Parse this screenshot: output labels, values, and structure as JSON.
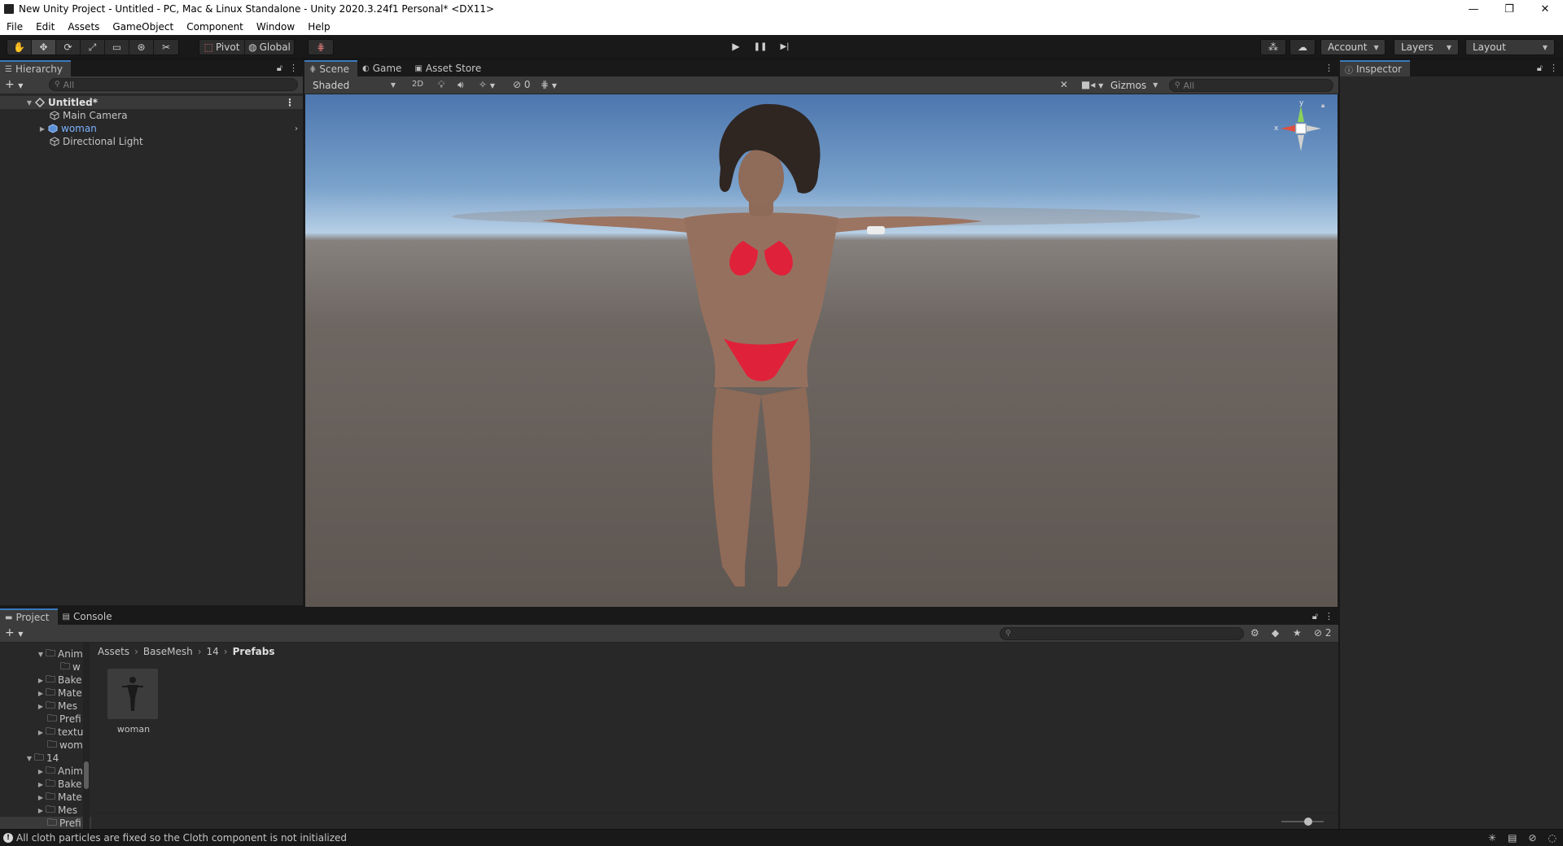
{
  "window": {
    "title": "New Unity Project - Untitled - PC, Mac & Linux Standalone - Unity 2020.3.24f1 Personal* <DX11>",
    "controls": [
      "—",
      "❐",
      "✕"
    ]
  },
  "menu": [
    "File",
    "Edit",
    "Assets",
    "GameObject",
    "Component",
    "Window",
    "Help"
  ],
  "toolbar": {
    "tools": [
      "✋",
      "✥",
      "⟳",
      "⤢",
      "▭",
      "⊛",
      "✂"
    ],
    "pivot_label": "Pivot",
    "global_label": "Global",
    "grid_icon": "⋕",
    "play": "▶",
    "pause": "❚❚",
    "step": "▶|",
    "account_label": "Account",
    "layers_label": "Layers",
    "layout_label": "Layout"
  },
  "hierarchy": {
    "tab_label": "Hierarchy",
    "search_placeholder": "All",
    "scene_name": "Untitled*",
    "items": [
      {
        "label": "Main Camera"
      },
      {
        "label": "woman"
      },
      {
        "label": "Directional Light"
      }
    ]
  },
  "scene": {
    "tabs": [
      "Scene",
      "Game",
      "Asset Store"
    ],
    "shading_mode": "Shaded",
    "mode_2d": "2D",
    "hidden_count": "0",
    "gizmos_label": "Gizmos",
    "search_placeholder": "All",
    "axis_labels": {
      "x": "x",
      "y": "y"
    }
  },
  "inspector": {
    "tab_label": "Inspector"
  },
  "project": {
    "tabs": [
      "Project",
      "Console"
    ],
    "breadcrumb": [
      "Assets",
      "BaseMesh",
      "14",
      "Prefabs"
    ],
    "hidden_count": "2",
    "folder_tree": [
      {
        "label": "Anim",
        "depth": 2,
        "expanded": true
      },
      {
        "label": "w",
        "depth": 3
      },
      {
        "label": "Bake",
        "depth": 2
      },
      {
        "label": "Mate",
        "depth": 2
      },
      {
        "label": "Mes",
        "depth": 2
      },
      {
        "label": "Prefi",
        "depth": 2
      },
      {
        "label": "textu",
        "depth": 2
      },
      {
        "label": "wom",
        "depth": 2
      },
      {
        "label": "14",
        "depth": 1,
        "expanded": true
      },
      {
        "label": "Anim",
        "depth": 2
      },
      {
        "label": "Bake",
        "depth": 2
      },
      {
        "label": "Mate",
        "depth": 2
      },
      {
        "label": "Mes",
        "depth": 2
      },
      {
        "label": "Prefi",
        "depth": 2
      }
    ],
    "assets": [
      {
        "label": "woman"
      }
    ]
  },
  "status": {
    "message": "All cloth particles are fixed so the Cloth component is not initialized"
  },
  "colors": {
    "accent": "#3a79bb",
    "selected_text": "#7cb1ff",
    "bikini": "#e0213a",
    "skin": "#9c7462"
  }
}
